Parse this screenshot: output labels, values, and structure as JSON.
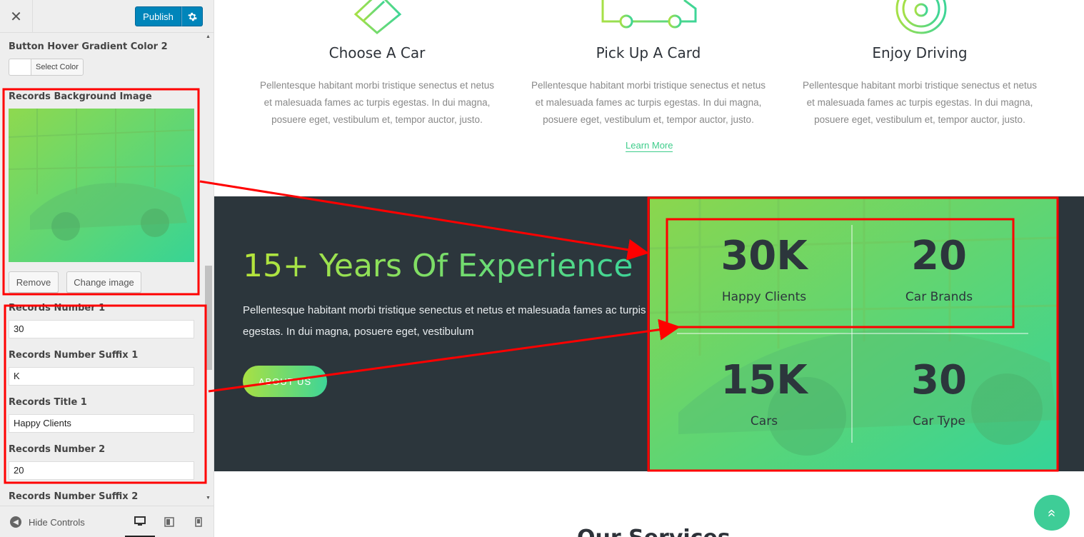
{
  "sidebar": {
    "close_glyph": "✕",
    "publish_label": "Publish",
    "gear_icon": "gear-icon",
    "controls": {
      "hover_color2_label": "Button Hover Gradient Color 2",
      "select_color_label": "Select Color",
      "bg_image_label": "Records Background Image",
      "remove_label": "Remove",
      "change_image_label": "Change image",
      "number1_label": "Records Number 1",
      "number1_value": "30",
      "suffix1_label": "Records Number Suffix 1",
      "suffix1_value": "K",
      "title1_label": "Records Title 1",
      "title1_value": "Happy Clients",
      "number2_label": "Records Number 2",
      "number2_value": "20",
      "suffix2_label": "Records Number Suffix 2"
    },
    "footer": {
      "hide_controls_label": "Hide Controls"
    }
  },
  "preview": {
    "features": [
      {
        "title": "Choose A Car",
        "text": "Pellentesque habitant morbi tristique senectus et netus et malesuada fames ac turpis egestas. In dui magna, posuere eget, vestibulum et, tempor auctor, justo."
      },
      {
        "title": "Pick Up A Card",
        "text": "Pellentesque habitant morbi tristique senectus et netus et malesuada fames ac turpis egestas. In dui magna, posuere eget, vestibulum et, tempor auctor, justo."
      },
      {
        "title": "Enjoy Driving",
        "text": "Pellentesque habitant morbi tristique senectus et netus et malesuada fames ac turpis egestas. In dui magna, posuere eget, vestibulum et, tempor auctor, justo."
      }
    ],
    "learn_more": "Learn More",
    "records": {
      "heading": "15+ Years Of Experience",
      "text": "Pellentesque habitant morbi tristique senectus et netus et malesuada fames ac turpis egestas. In dui magna, posuere eget, vestibulum",
      "button": "ABOUT US",
      "stats": [
        {
          "number": "30K",
          "label": "Happy Clients"
        },
        {
          "number": "20",
          "label": "Car Brands"
        },
        {
          "number": "15K",
          "label": "Cars"
        },
        {
          "number": "30",
          "label": "Car Type"
        }
      ]
    },
    "services_title": "Our Services",
    "scroll_top_glyph": "«"
  },
  "colors": {
    "accent_green": "#3ecd8b",
    "gradient_start": "#b7e53a",
    "gradient_end": "#3ed597",
    "dark_section": "#2c363c",
    "publish_blue": "#0085ba",
    "annotation_red": "#ff0000"
  }
}
